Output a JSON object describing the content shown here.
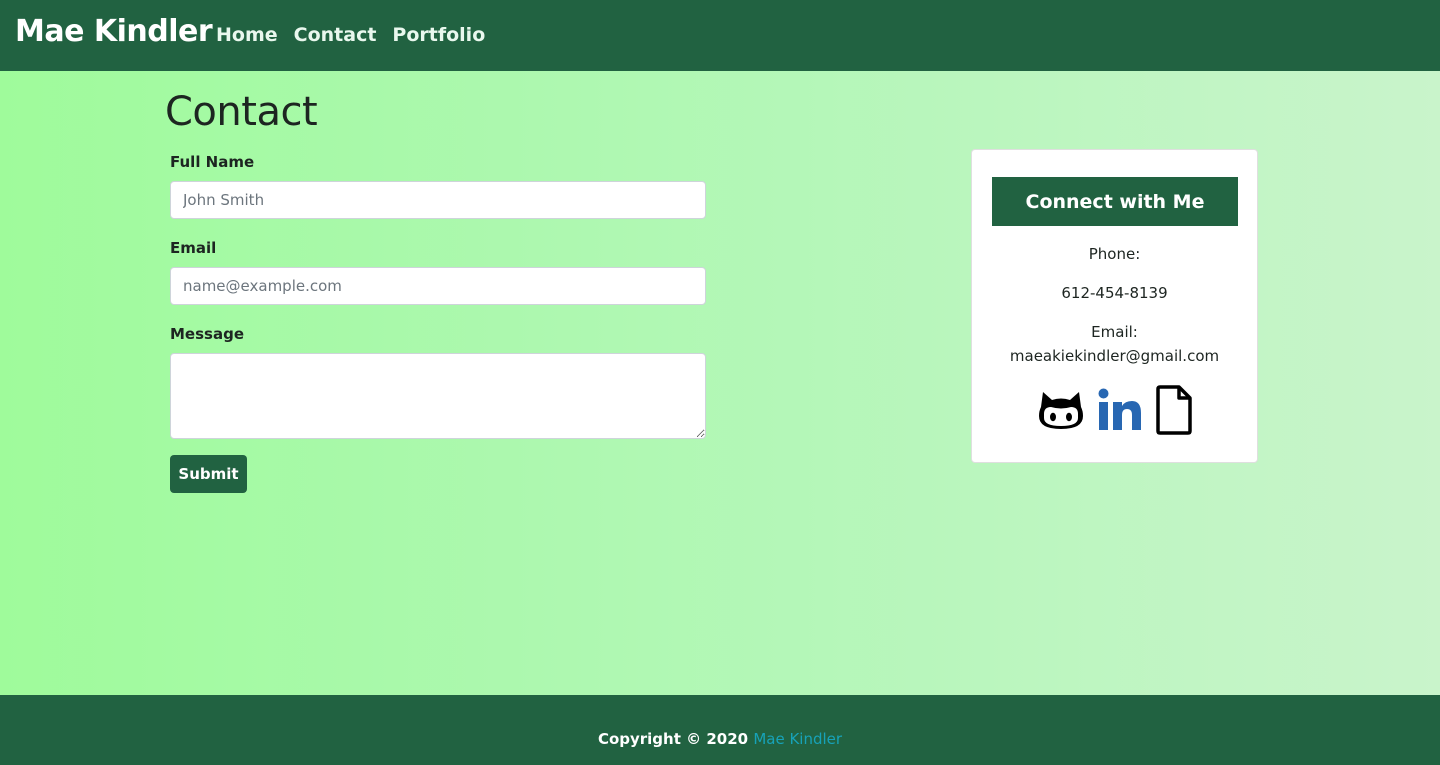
{
  "navbar": {
    "brand": "Mae Kindler",
    "links": [
      "Home",
      "Contact",
      "Portfolio"
    ]
  },
  "page": {
    "title": "Contact"
  },
  "form": {
    "name_label": "Full Name",
    "name_placeholder": "John Smith",
    "email_label": "Email",
    "email_placeholder": "name@example.com",
    "message_label": "Message",
    "submit_label": "Submit"
  },
  "card": {
    "header": "Connect with Me",
    "phone_label": "Phone:",
    "phone_value": "612-454-8139",
    "email_label": "Email:",
    "email_value": "maeakiekindler@gmail.com",
    "icons": [
      "github-icon",
      "linkedin-icon",
      "file-icon"
    ]
  },
  "footer": {
    "copyright": "Copyright © 2020",
    "name_link": "Mae Kindler"
  },
  "colors": {
    "primary": "#216241",
    "link": "#17a2b8",
    "linkedin": "#2867b2"
  }
}
